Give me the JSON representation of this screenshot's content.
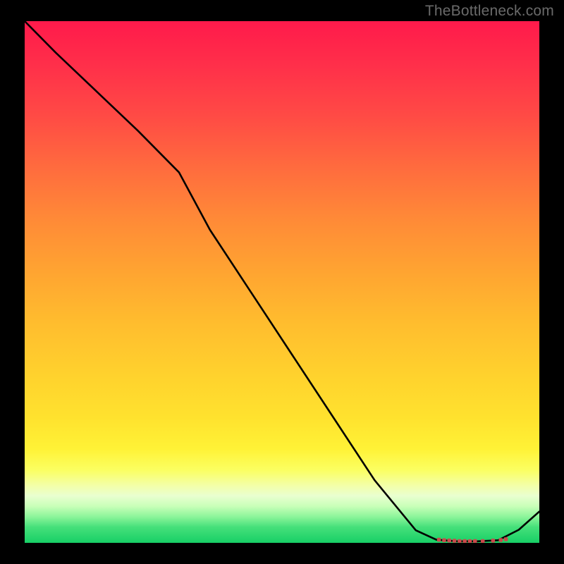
{
  "watermark_text": "TheBottleneck.com",
  "chart_data": {
    "type": "line",
    "title": "",
    "xlabel": "",
    "ylabel": "",
    "xlim": [
      0,
      100
    ],
    "ylim": [
      0,
      100
    ],
    "curve_x": [
      0,
      6,
      14,
      22,
      30,
      36,
      44,
      52,
      60,
      68,
      76,
      80,
      84,
      88,
      92,
      96,
      100
    ],
    "curve_y": [
      100,
      94,
      86.5,
      79,
      71,
      60,
      48,
      36,
      24,
      12,
      2.4,
      0.6,
      0.3,
      0.3,
      0.5,
      2.5,
      6
    ],
    "markers_x": [
      80.5,
      81.5,
      82.5,
      83.5,
      84.5,
      85.5,
      86.5,
      87.5,
      89.0,
      91.0,
      92.5,
      93.5
    ],
    "markers_y": [
      0.6,
      0.5,
      0.45,
      0.4,
      0.35,
      0.33,
      0.32,
      0.33,
      0.35,
      0.42,
      0.55,
      0.7
    ],
    "gradient_colors": {
      "top": "#ff1a4b",
      "mid_upper": "#ff8a37",
      "mid": "#ffe22e",
      "mid_lower": "#fbff61",
      "bottom": "#18cf66"
    },
    "accent_color": "#c94a4a",
    "line_color": "#000000"
  }
}
